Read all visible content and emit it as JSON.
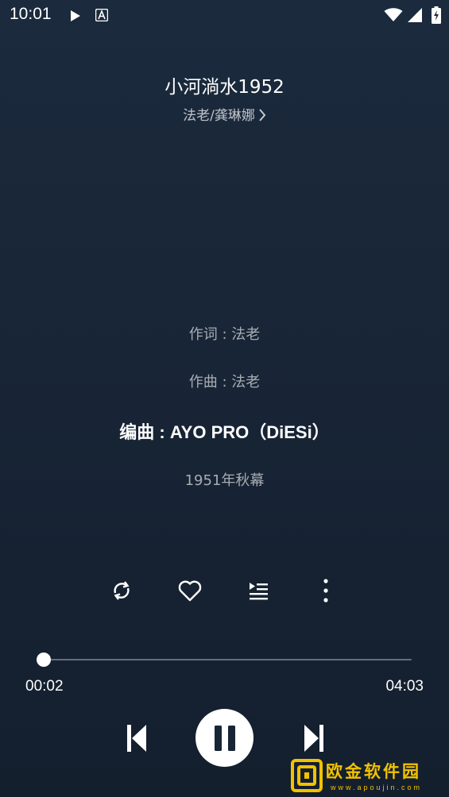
{
  "status_bar": {
    "time": "10:01",
    "icons": [
      "play-icon",
      "accessibility-a-icon",
      "wifi-icon",
      "signal-icon",
      "battery-charging-icon"
    ]
  },
  "song": {
    "title": "小河淌水1952",
    "artist": "法老/龚琳娜"
  },
  "lyrics": [
    {
      "text": "作词 : 法老",
      "active": false
    },
    {
      "text": "作曲 : 法老",
      "active": false
    },
    {
      "text": "编曲 : AYO PRO（DiESi）",
      "active": true
    },
    {
      "text": "1951年秋幕",
      "active": false
    }
  ],
  "actions": {
    "icons": [
      "repeat-icon",
      "heart-icon",
      "playlist-icon",
      "more-vertical-icon"
    ]
  },
  "progress": {
    "current_time": "00:02",
    "total_time": "04:03",
    "fraction": 0.008
  },
  "controls": {
    "icons": [
      "skip-previous-icon",
      "pause-icon",
      "skip-next-icon"
    ]
  },
  "watermark": {
    "text": "欧金软件园",
    "url": "www.apoujin.com",
    "color": "#f2c200"
  },
  "colors": {
    "background": "#182536",
    "text": "#ffffff",
    "accent_watermark": "#f2c200"
  }
}
